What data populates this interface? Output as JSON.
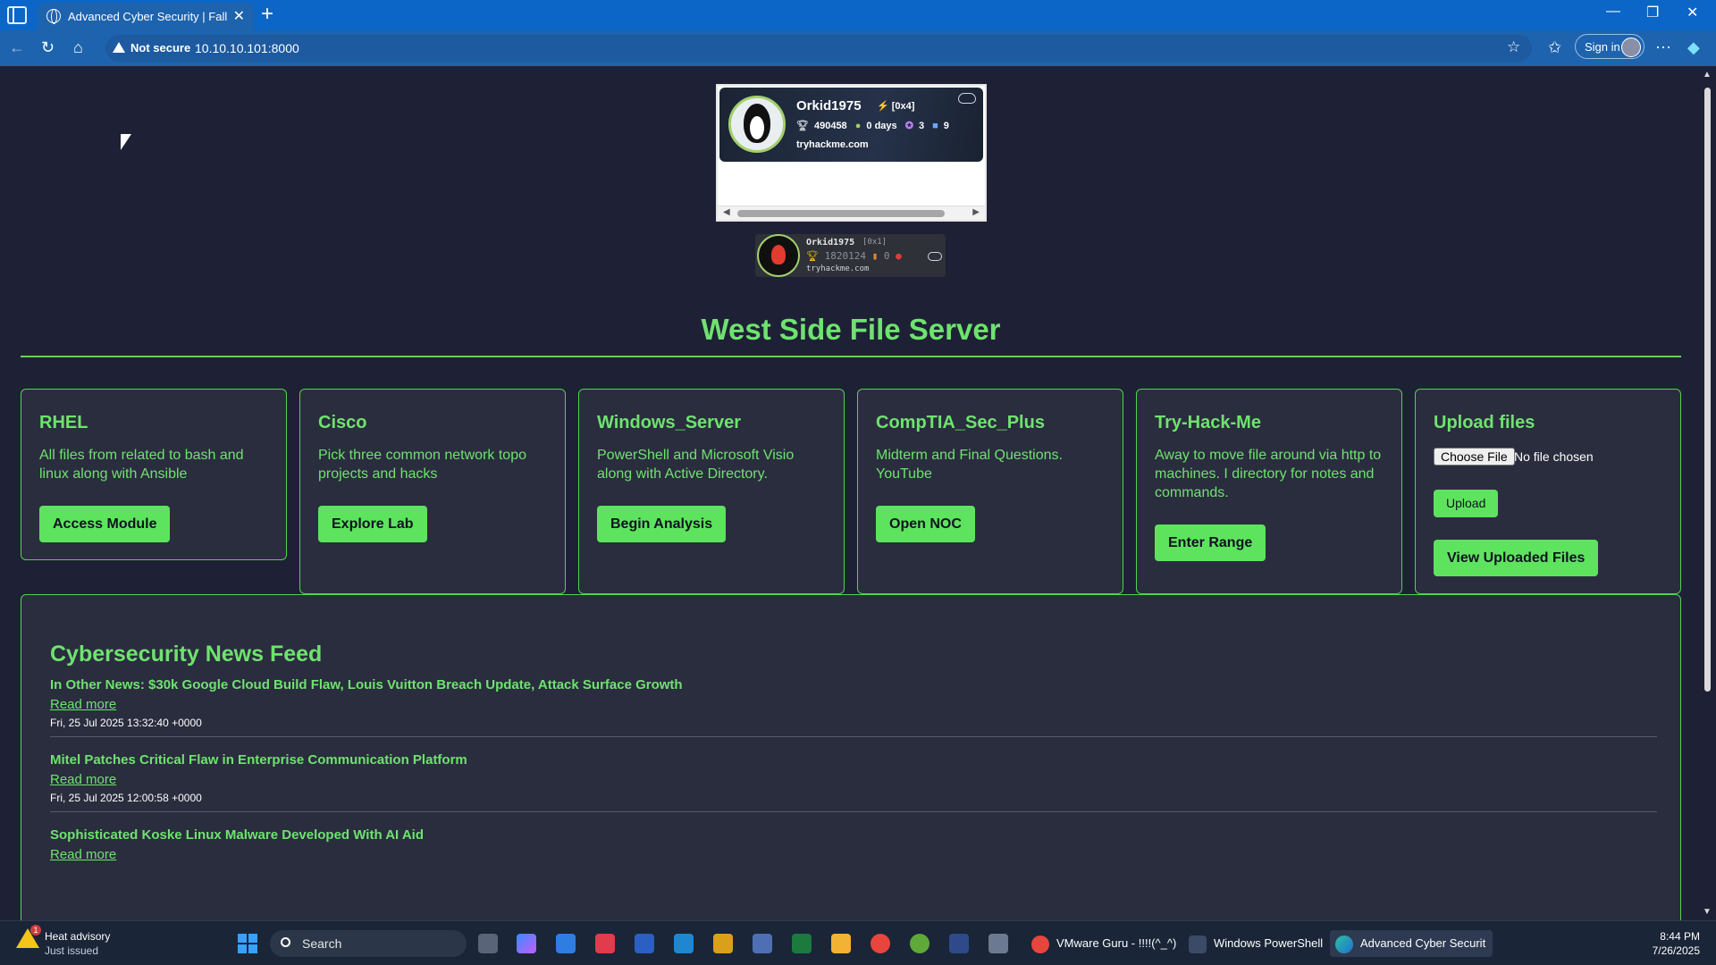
{
  "browser": {
    "tab_title": "Advanced Cyber Security | Fall Da",
    "security_label": "Not secure",
    "url": "10.10.10.101:8000",
    "signin_label": "Sign in"
  },
  "badge_primary": {
    "username": "Orkid1975",
    "rank": "[0x4]",
    "points": "490458",
    "streak": "0 days",
    "awards": "3",
    "rooms": "9",
    "site": "tryhackme.com"
  },
  "badge_secondary": {
    "username": "Orkid1975",
    "rank": "[0x1]",
    "points": "1820124",
    "rooms": "0",
    "site": "tryhackme.com"
  },
  "site_title": "West Side File Server",
  "cards": [
    {
      "title": "RHEL",
      "description": "All files from related to bash and linux along with Ansible",
      "button": "Access Module"
    },
    {
      "title": "Cisco",
      "description": "Pick three common network topo projects and hacks",
      "button": "Explore Lab"
    },
    {
      "title": "Windows_Server",
      "description": "PowerShell and Microsoft Visio along with Active Directory.",
      "button": "Begin Analysis"
    },
    {
      "title": "CompTIA_Sec_Plus",
      "description": "Midterm and Final Questions. YouTube",
      "button": "Open NOC"
    },
    {
      "title": "Try-Hack-Me",
      "description": "Away to move file around via http to machines. I directory for notes and commands.",
      "button": "Enter Range"
    }
  ],
  "upload": {
    "title": "Upload files",
    "choose_label": "Choose File",
    "no_file_label": "No file chosen",
    "upload_label": "Upload",
    "view_label": "View Uploaded Files"
  },
  "news": {
    "heading": "Cybersecurity News Feed",
    "read_more": "Read more",
    "items": [
      {
        "title": "In Other News: $30k Google Cloud Build Flaw, Louis Vuitton Breach Update, Attack Surface Growth",
        "date": "Fri, 25 Jul 2025 13:32:40 +0000"
      },
      {
        "title": "Mitel Patches Critical Flaw in Enterprise Communication Platform",
        "date": "Fri, 25 Jul 2025 12:00:58 +0000"
      },
      {
        "title": "Sophisticated Koske Linux Malware Developed With AI Aid",
        "date": ""
      }
    ]
  },
  "taskbar": {
    "weather_title": "Heat advisory",
    "weather_sub": "Just issued",
    "weather_count": "1",
    "search_label": "Search",
    "apps": [
      {
        "label": "VMware Guru - !!!!(^_^)"
      },
      {
        "label": "Windows PowerShell"
      },
      {
        "label": "Advanced Cyber Securit"
      }
    ],
    "time": "8:44 PM",
    "date": "7/26/2025"
  },
  "colors": {
    "accent": "#5ee35e",
    "page_bg": "#1e2135",
    "card_bg": "#2a2d3e",
    "browser_blue": "#1e63ad"
  }
}
